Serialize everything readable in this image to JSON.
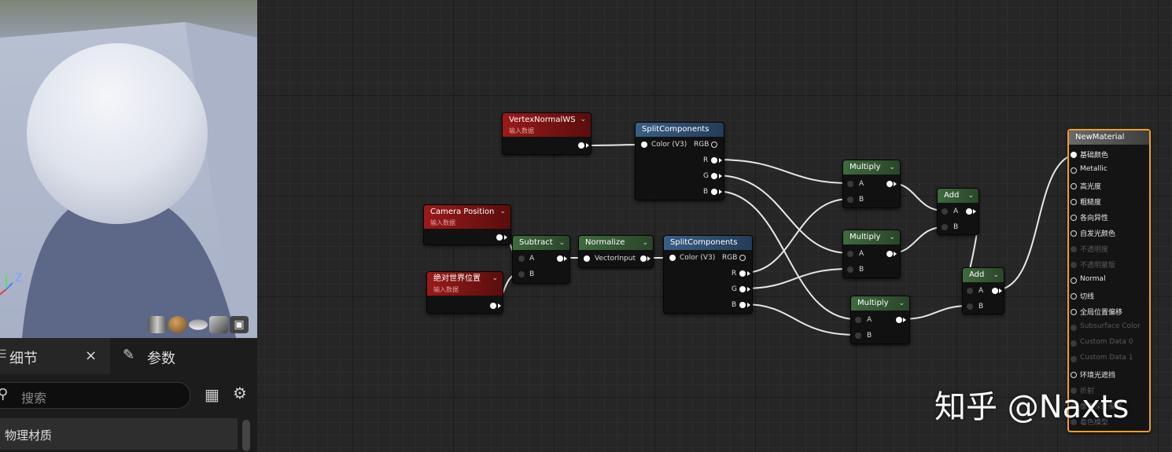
{
  "viewport": {
    "axis_z": "Z",
    "preview_buttons": [
      "cylinder-preview",
      "sphere-preview",
      "plane-preview",
      "cube-preview",
      "teapot-preview"
    ]
  },
  "details": {
    "tab_details": "细节",
    "tab_close": "×",
    "tab_params": "参数",
    "search_placeholder": "搜索",
    "category": "物理材质"
  },
  "nodes": {
    "vertex_normal": {
      "title": "VertexNormalWS",
      "subtitle": "输入数据"
    },
    "camera_pos": {
      "title": "Camera Position",
      "subtitle": "输入数据"
    },
    "abs_world_pos": {
      "title": "绝对世界位置",
      "subtitle": "输入数据"
    },
    "split1": {
      "title": "SplitComponents",
      "in": "Color (V3)",
      "out": [
        "RGB",
        "R",
        "G",
        "B"
      ]
    },
    "subtract": {
      "title": "Subtract",
      "in": [
        "A",
        "B"
      ]
    },
    "normalize": {
      "title": "Normalize",
      "in": "VectorInput"
    },
    "split2": {
      "title": "SplitComponents",
      "in": "Color (V3)",
      "out": [
        "RGB",
        "R",
        "G",
        "B"
      ]
    },
    "multiply1": {
      "title": "Multiply",
      "in": [
        "A",
        "B"
      ]
    },
    "multiply2": {
      "title": "Multiply",
      "in": [
        "A",
        "B"
      ]
    },
    "multiply3": {
      "title": "Multiply",
      "in": [
        "A",
        "B"
      ]
    },
    "add1": {
      "title": "Add",
      "in": [
        "A",
        "B"
      ]
    },
    "add2": {
      "title": "Add",
      "in": [
        "A",
        "B"
      ]
    }
  },
  "material": {
    "title": "NewMaterial",
    "inputs": [
      {
        "label": "基础颜色",
        "active": true
      },
      {
        "label": "Metallic",
        "active": true
      },
      {
        "label": "高光度",
        "active": true
      },
      {
        "label": "粗糙度",
        "active": true
      },
      {
        "label": "各向异性",
        "active": true
      },
      {
        "label": "自发光颜色",
        "active": true
      },
      {
        "label": "不透明度",
        "active": false
      },
      {
        "label": "不透明蒙版",
        "active": false
      },
      {
        "label": "Normal",
        "active": true
      },
      {
        "label": "切线",
        "active": true
      },
      {
        "label": "全局位置偏移",
        "active": true
      },
      {
        "label": "Subsurface Color",
        "active": false
      },
      {
        "label": "Custom Data 0",
        "active": false
      },
      {
        "label": "Custom Data 1",
        "active": false
      },
      {
        "label": "环境光遮挡",
        "active": true
      },
      {
        "label": "折射",
        "active": false
      },
      {
        "label": "像素深度偏移",
        "active": false
      },
      {
        "label": "着色模型",
        "active": false
      }
    ]
  },
  "watermark": "知乎 @Naxts"
}
